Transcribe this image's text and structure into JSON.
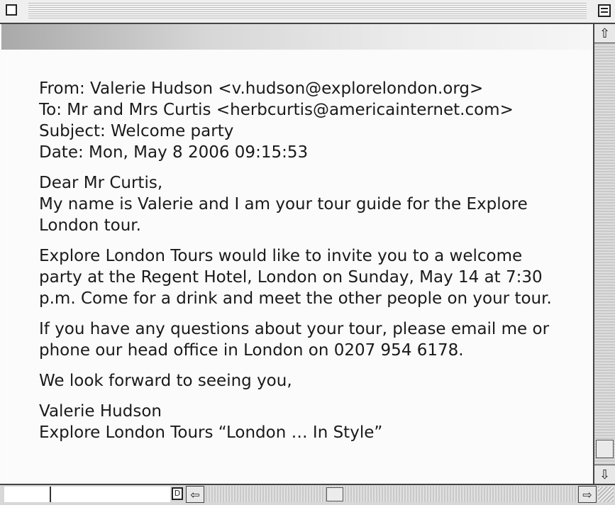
{
  "window": {
    "title": ""
  },
  "email": {
    "from": "From: Valerie Hudson <v.hudson@explorelondon.org>",
    "to": "To: Mr and Mrs Curtis <herbcurtis@americainternet.com>",
    "subject": "Subject: Welcome party",
    "date": "Date: Mon, May 8 2006 09:15:53",
    "body": [
      [
        "Dear Mr Curtis,",
        "My name is Valerie and I am your tour guide for the Explore",
        "London tour."
      ],
      [
        "Explore London Tours would like to invite you to a welcome",
        "party at the Regent Hotel, London on Sunday, May 14 at 7:30",
        "p.m. Come for a drink and meet the other people on your tour."
      ],
      [
        "If you have any questions about your tour, please email me or",
        "phone our head office in London on 0207 954 6178."
      ],
      [
        "We look forward to seeing you,"
      ],
      [
        "Valerie Hudson",
        "Explore London Tours “London … In Style”"
      ]
    ]
  },
  "icons": {
    "close": "close-box-icon",
    "zoom": "zoom-box-icon",
    "scroll_up": "arrow-up-icon",
    "scroll_down": "arrow-down-icon",
    "scroll_left": "arrow-left-icon",
    "scroll_right": "arrow-right-icon",
    "page": "page-icon",
    "grow": "resize-grip-icon"
  },
  "glyphs": {
    "up": "⇧",
    "down": "⇩",
    "left": "⇦",
    "right": "⇨",
    "page": "D"
  }
}
